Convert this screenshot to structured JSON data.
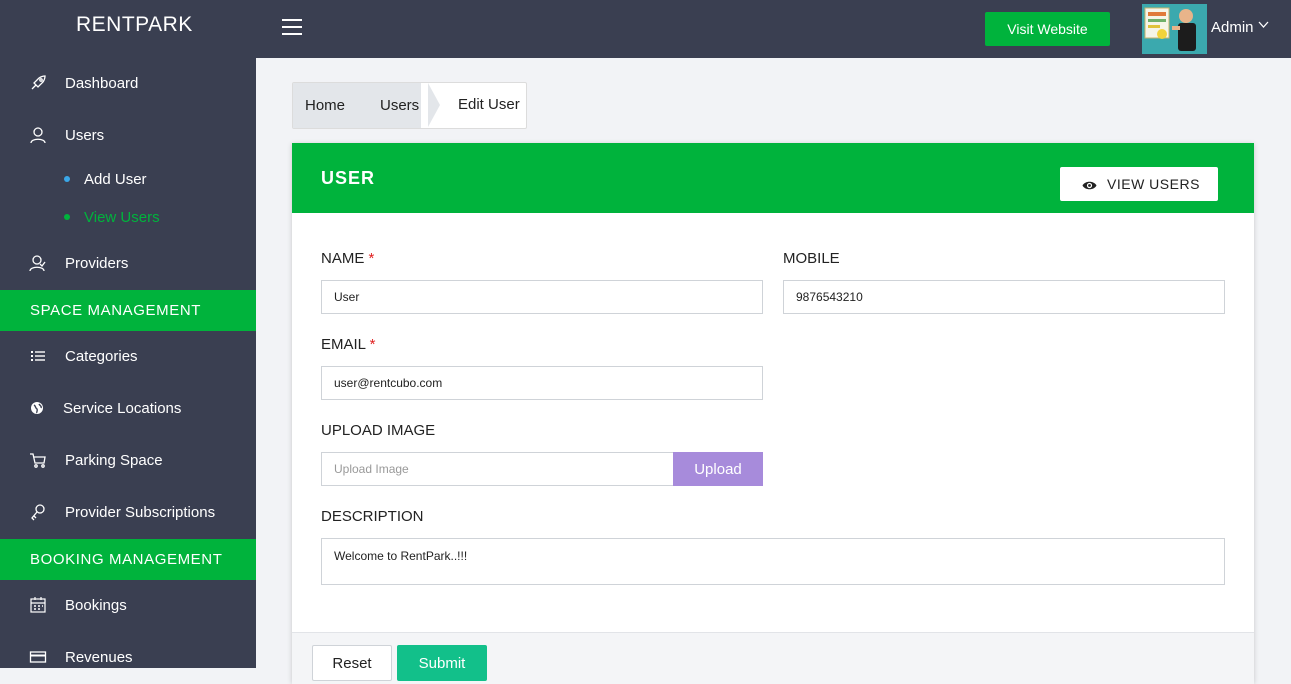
{
  "header": {
    "brand": "RENTPARK",
    "visit_website": "Visit Website",
    "user_name": "Admin"
  },
  "sidebar": {
    "items": [
      {
        "label": "Dashboard",
        "icon": "rocket-icon"
      },
      {
        "label": "Users",
        "icon": "user-icon"
      },
      {
        "label": "Providers",
        "icon": "providers-icon"
      },
      {
        "label": "Categories",
        "icon": "list-icon"
      },
      {
        "label": "Service Locations",
        "icon": "globe-icon"
      },
      {
        "label": "Parking Space",
        "icon": "cart-icon"
      },
      {
        "label": "Provider Subscriptions",
        "icon": "key-icon"
      },
      {
        "label": "Bookings",
        "icon": "calendar-icon"
      },
      {
        "label": "Revenues",
        "icon": "card-icon"
      }
    ],
    "sub_items": [
      {
        "label": "Add User",
        "color": "#3aa7e8",
        "active": false
      },
      {
        "label": "View Users",
        "color": "#00b33c",
        "active": true
      }
    ],
    "sections": [
      "SPACE MANAGEMENT",
      "BOOKING MANAGEMENT"
    ]
  },
  "breadcrumb": {
    "items": [
      "Home",
      "Users",
      "Edit User"
    ]
  },
  "card": {
    "title": "USER",
    "view_users": "VIEW USERS"
  },
  "form": {
    "name_label": "NAME",
    "name_value": "User",
    "mobile_label": "MOBILE",
    "mobile_value": "9876543210",
    "email_label": "EMAIL",
    "email_value": "user@rentcubo.com",
    "required_mark": "*",
    "upload_label": "UPLOAD IMAGE",
    "upload_placeholder": "Upload Image",
    "upload_button": "Upload",
    "description_label": "DESCRIPTION",
    "description_value": "Welcome to RentPark..!!!",
    "reset": "Reset",
    "submit": "Submit"
  },
  "colors": {
    "sidebar_bg": "#3a3f51",
    "accent_green": "#00b33c",
    "upload_purple": "#a78bdb",
    "submit_teal": "#12c08a"
  }
}
